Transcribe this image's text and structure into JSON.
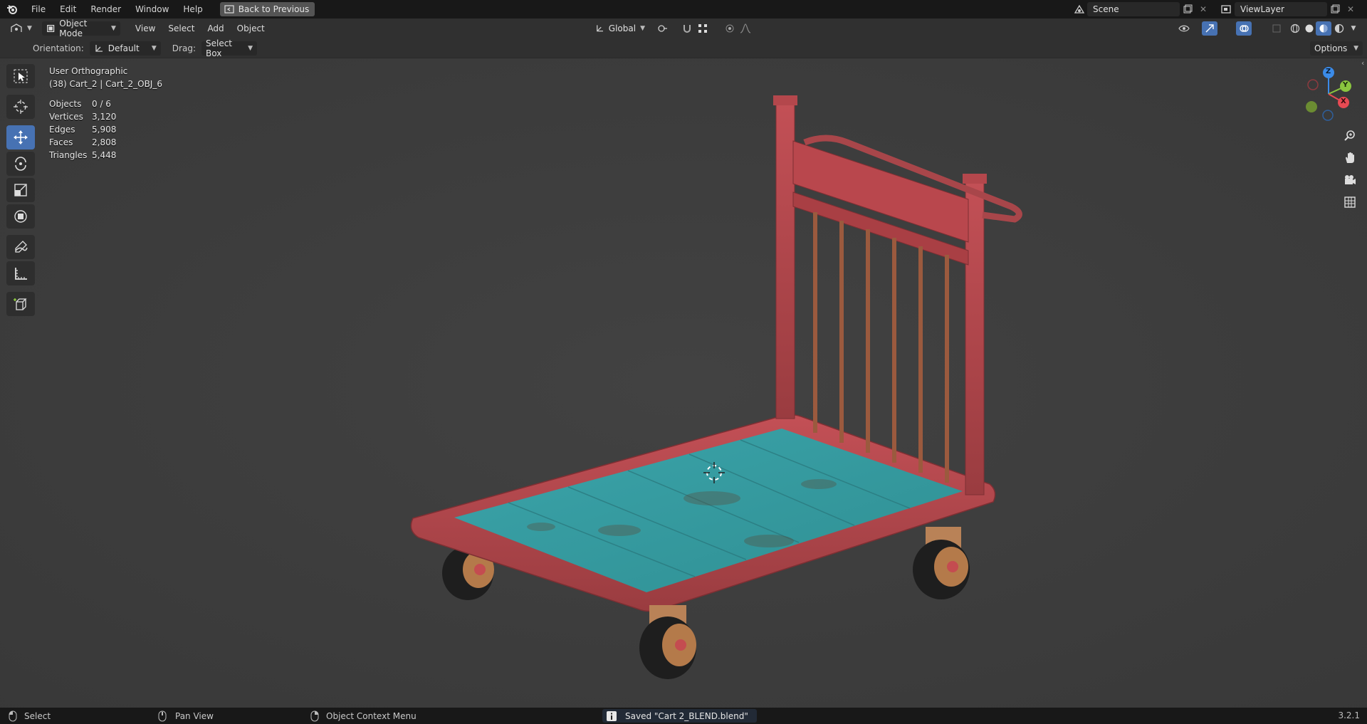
{
  "top_menu": {
    "items": [
      "File",
      "Edit",
      "Render",
      "Window",
      "Help"
    ],
    "back_button": "Back to Previous",
    "scene": "Scene",
    "view_layer": "ViewLayer"
  },
  "header": {
    "mode": "Object Mode",
    "menus": [
      "View",
      "Select",
      "Add",
      "Object"
    ],
    "transform_orientation": "Global"
  },
  "tool_settings": {
    "orientation_label": "Orientation:",
    "orientation_value": "Default",
    "drag_label": "Drag:",
    "drag_value": "Select Box",
    "options": "Options"
  },
  "viewport": {
    "view_name": "User Orthographic",
    "object_info": "(38) Cart_2 | Cart_2_OBJ_6",
    "stats": [
      {
        "label": "Objects",
        "value": "0 / 6"
      },
      {
        "label": "Vertices",
        "value": "3,120"
      },
      {
        "label": "Edges",
        "value": "5,908"
      },
      {
        "label": "Faces",
        "value": "2,808"
      },
      {
        "label": "Triangles",
        "value": "5,448"
      }
    ],
    "gizmo": {
      "x": "X",
      "y": "Y",
      "z": "Z"
    }
  },
  "status_bar": {
    "select": "Select",
    "pan_view": "Pan View",
    "context_menu": "Object Context Menu",
    "message": "Saved \"Cart 2_BLEND.blend\"",
    "version": "3.2.1"
  },
  "colors": {
    "accent": "#4772b3",
    "cart_frame": "#b54a4e",
    "cart_deck": "#3fa3a8",
    "axis_x": "#e74a53",
    "axis_y": "#8ac53f",
    "axis_z": "#3b8be8"
  }
}
